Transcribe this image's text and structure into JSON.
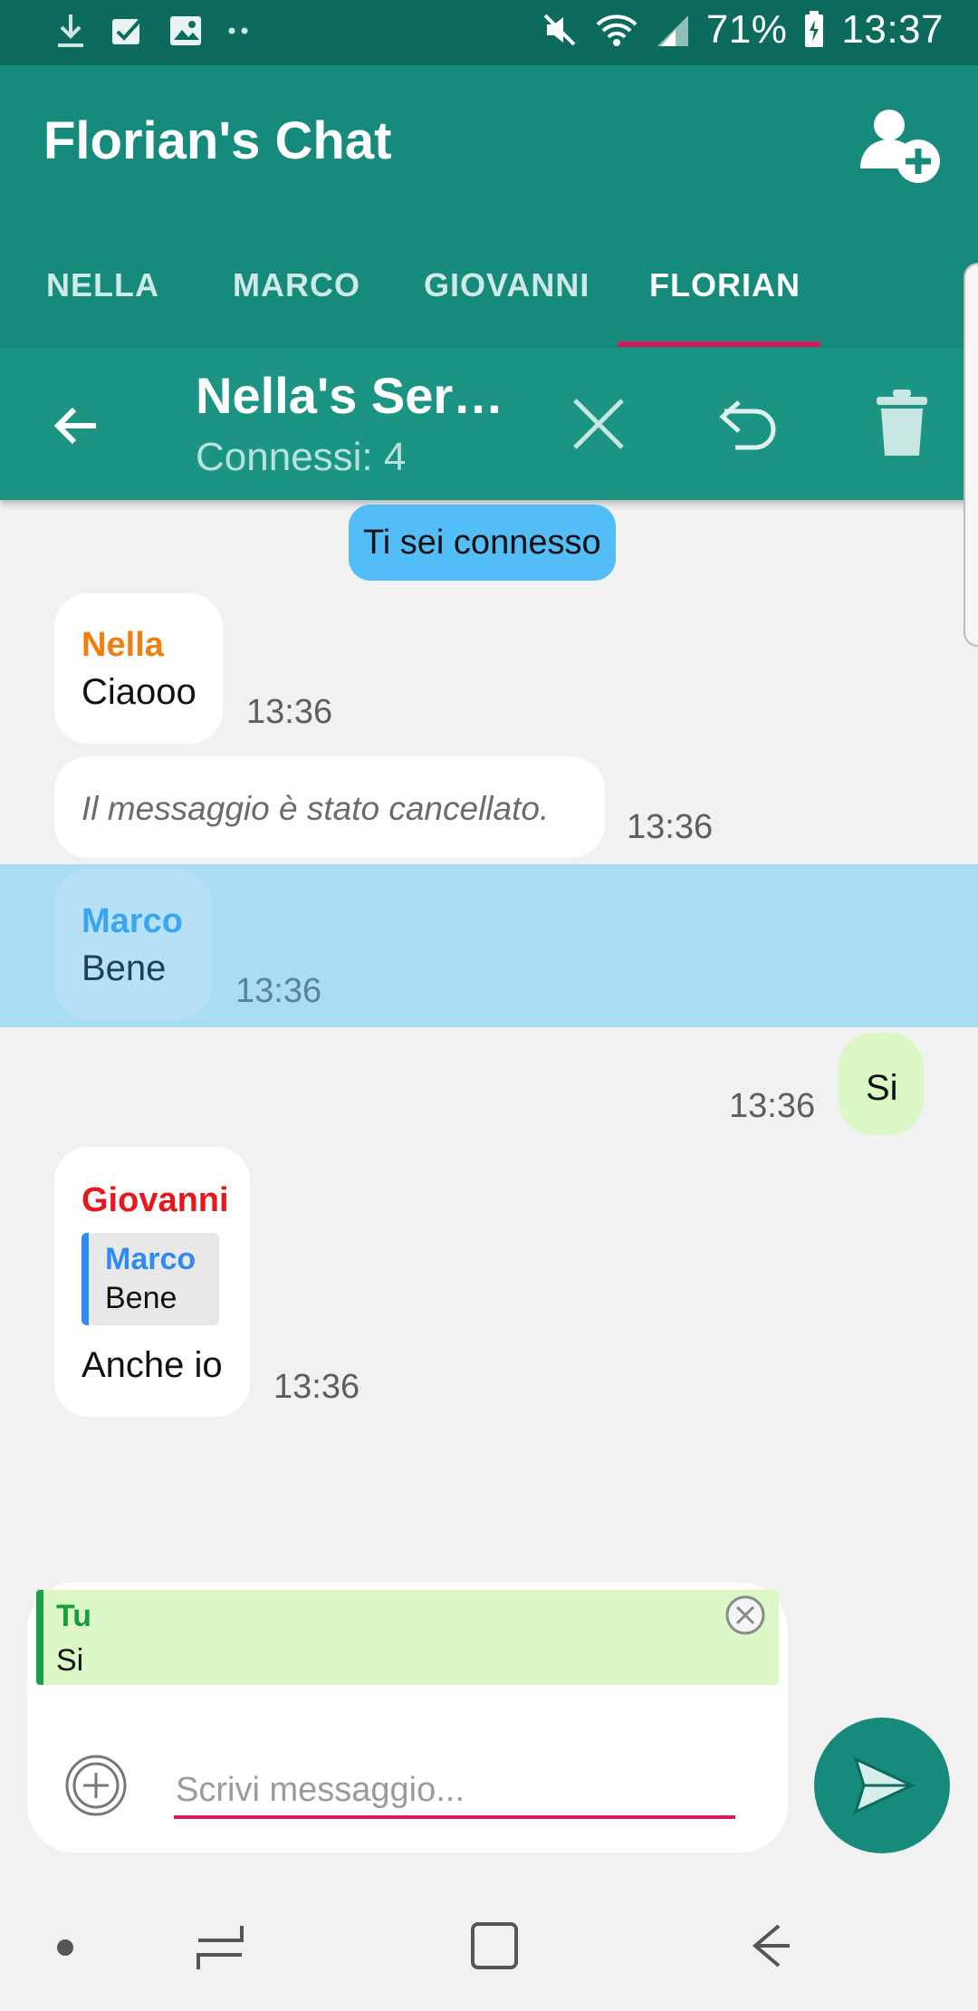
{
  "status_bar": {
    "battery": "71%",
    "time": "13:37"
  },
  "app_bar": {
    "title": "Florian's Chat"
  },
  "tabs": [
    {
      "label": "NELLA"
    },
    {
      "label": "MARCO"
    },
    {
      "label": "GIOVANNI"
    },
    {
      "label": "FLORIAN",
      "active": true
    }
  ],
  "chat_header": {
    "title": "Nella's Ser…",
    "subtitle": "Connessi: 4"
  },
  "messages": {
    "system": "Ti sei connesso",
    "m1": {
      "sender": "Nella",
      "sender_color": "#f07f10",
      "text": "Ciaooo",
      "time": "13:36"
    },
    "m2": {
      "text": "Il messaggio è stato cancellato.",
      "time": "13:36"
    },
    "m3": {
      "sender": "Marco",
      "sender_color": "#3aa5f0",
      "text": "Bene",
      "time": "13:36"
    },
    "m4": {
      "text": "Si",
      "time": "13:36",
      "bubble_color": "#dcf7c6"
    },
    "m5": {
      "sender": "Giovanni",
      "sender_color": "#e8171b",
      "quote_sender": "Marco",
      "quote_text": "Bene",
      "text": "Anche io",
      "time": "13:36"
    }
  },
  "composer": {
    "reply_sender": "Tu",
    "reply_text": "Si",
    "placeholder": "Scrivi messaggio..."
  },
  "colors": {
    "status_bar": "#0d6b5e",
    "app_bar": "#168b7c",
    "accent": "#d81b60",
    "own_bubble": "#dcf7c6",
    "selected_row": "#a9dcf5"
  },
  "icons": {
    "status": [
      "download-icon",
      "check-icon",
      "image-icon",
      "more-dots-icon",
      "mute-icon",
      "wifi-icon",
      "signal-icon",
      "battery-icon"
    ],
    "app_bar": [
      "add-user-icon"
    ],
    "chat_header": [
      "back-arrow-icon",
      "close-icon",
      "reply-icon",
      "trash-icon"
    ],
    "composer": [
      "add-circle-icon",
      "send-icon",
      "close-circle-icon"
    ],
    "nav": [
      "dot-icon",
      "recents-icon",
      "home-icon",
      "back-icon"
    ]
  }
}
